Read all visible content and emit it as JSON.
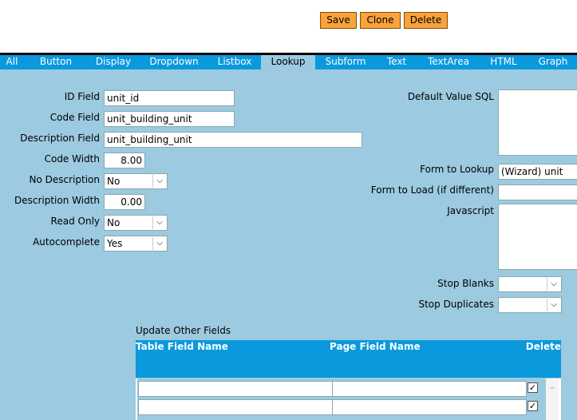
{
  "toolbar": {
    "save": "Save",
    "clone": "Clone",
    "delete": "Delete"
  },
  "tabs": [
    "All",
    "Button",
    "Display",
    "Dropdown",
    "Listbox",
    "Lookup",
    "Subform",
    "Text",
    "TextArea",
    "HTML",
    "Graph"
  ],
  "active_tab": "Lookup",
  "left": {
    "id_field": {
      "label": "ID Field",
      "value": "unit_id"
    },
    "code_field": {
      "label": "Code Field",
      "value": "unit_building_unit"
    },
    "description_field": {
      "label": "Description Field",
      "value": "unit_building_unit"
    },
    "code_width": {
      "label": "Code Width",
      "value": "8.00"
    },
    "no_description": {
      "label": "No Description",
      "value": "No"
    },
    "description_width": {
      "label": "Description Width",
      "value": "0.00"
    },
    "read_only": {
      "label": "Read Only",
      "value": "No"
    },
    "autocomplete": {
      "label": "Autocomplete",
      "value": "Yes"
    }
  },
  "right": {
    "default_value_sql": {
      "label": "Default Value SQL",
      "value": ""
    },
    "form_to_lookup": {
      "label": "Form to Lookup",
      "value": "(Wizard) unit"
    },
    "form_to_load": {
      "label": "Form to Load (if different)",
      "value": ""
    },
    "javascript": {
      "label": "Javascript",
      "value": ""
    },
    "stop_blanks": {
      "label": "Stop Blanks",
      "value": ""
    },
    "stop_duplicates": {
      "label": "Stop Duplicates",
      "value": ""
    }
  },
  "update_other_fields": {
    "title": "Update Other Fields",
    "columns": [
      "Table Field Name",
      "Page Field Name",
      "Delete"
    ],
    "rows": [
      {
        "table_field": "",
        "page_field": "",
        "delete": true
      },
      {
        "table_field": "",
        "page_field": "",
        "delete": true
      }
    ]
  },
  "icons": {
    "dropdown": "chevron-down-icon",
    "checkbox": "checkmark-icon",
    "scroll_up": "chevron-up-icon"
  }
}
